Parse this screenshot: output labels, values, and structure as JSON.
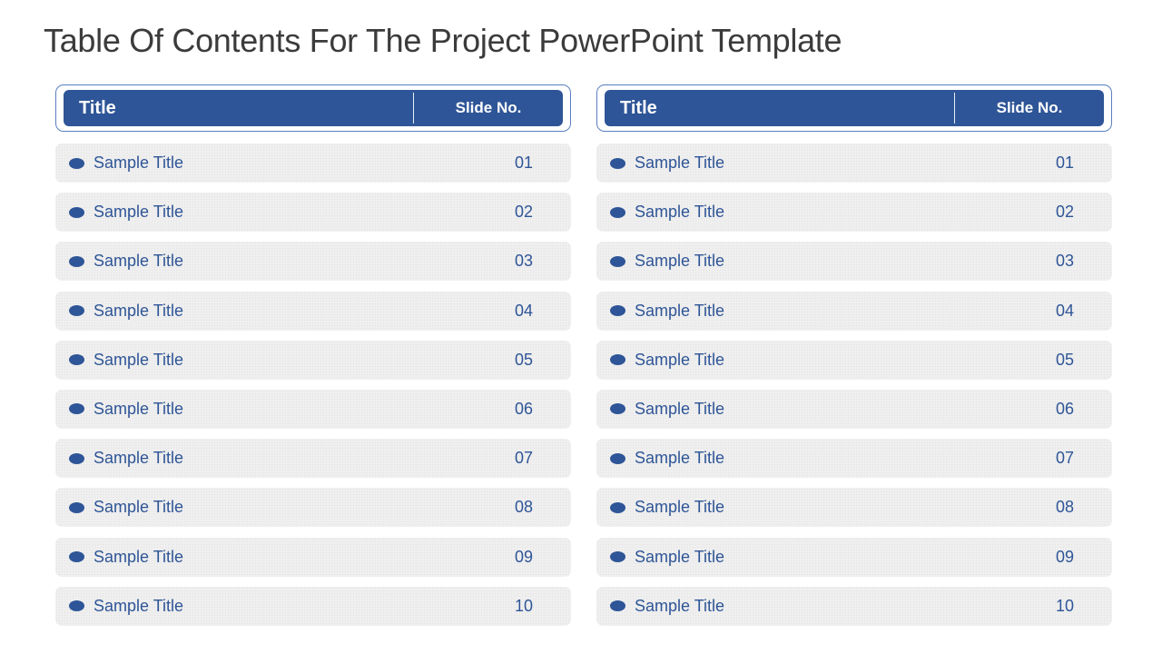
{
  "slide": {
    "title": "Table Of Contents For The Project PowerPoint Template"
  },
  "theme": {
    "accent": "#2e5597",
    "row_background": "#efefef",
    "title_color": "#3b3b3b"
  },
  "tables": [
    {
      "header": {
        "title": "Title",
        "slide_no": "Slide No."
      },
      "rows": [
        {
          "title": "Sample Title",
          "slide_no": "01"
        },
        {
          "title": "Sample Title",
          "slide_no": "02"
        },
        {
          "title": "Sample Title",
          "slide_no": "03"
        },
        {
          "title": "Sample Title",
          "slide_no": "04"
        },
        {
          "title": "Sample Title",
          "slide_no": "05"
        },
        {
          "title": "Sample Title",
          "slide_no": "06"
        },
        {
          "title": "Sample Title",
          "slide_no": "07"
        },
        {
          "title": "Sample Title",
          "slide_no": "08"
        },
        {
          "title": "Sample Title",
          "slide_no": "09"
        },
        {
          "title": "Sample Title",
          "slide_no": "10"
        }
      ]
    },
    {
      "header": {
        "title": "Title",
        "slide_no": "Slide No."
      },
      "rows": [
        {
          "title": "Sample Title",
          "slide_no": "01"
        },
        {
          "title": "Sample Title",
          "slide_no": "02"
        },
        {
          "title": "Sample Title",
          "slide_no": "03"
        },
        {
          "title": "Sample Title",
          "slide_no": "04"
        },
        {
          "title": "Sample Title",
          "slide_no": "05"
        },
        {
          "title": "Sample Title",
          "slide_no": "06"
        },
        {
          "title": "Sample Title",
          "slide_no": "07"
        },
        {
          "title": "Sample Title",
          "slide_no": "08"
        },
        {
          "title": "Sample Title",
          "slide_no": "09"
        },
        {
          "title": "Sample Title",
          "slide_no": "10"
        }
      ]
    }
  ]
}
